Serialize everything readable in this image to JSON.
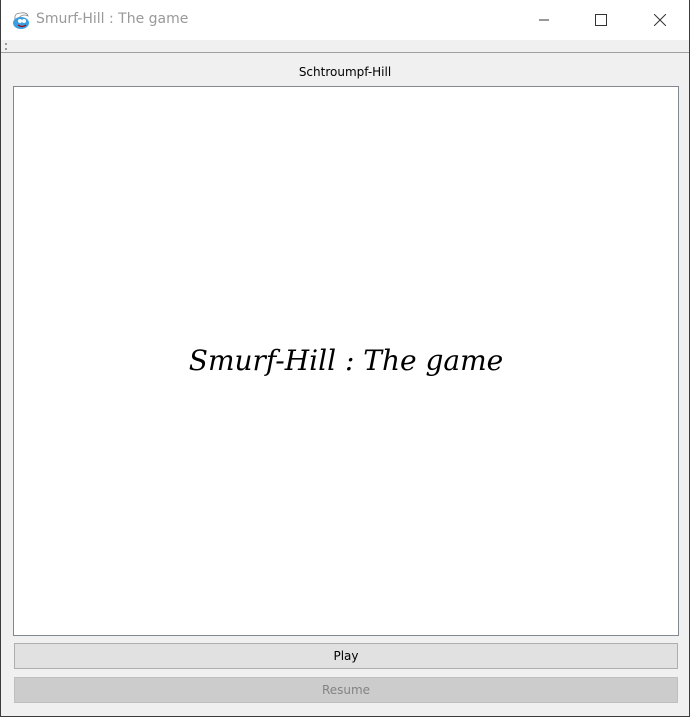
{
  "window": {
    "title": "Smurf-Hill : The game"
  },
  "header_label": "Schtroumpf-Hill",
  "canvas": {
    "title": "Smurf-Hill : The game"
  },
  "buttons": {
    "play": "Play",
    "resume": "Resume"
  },
  "controls": {
    "minimize": "—",
    "maximize": "☐",
    "close": "✕"
  }
}
